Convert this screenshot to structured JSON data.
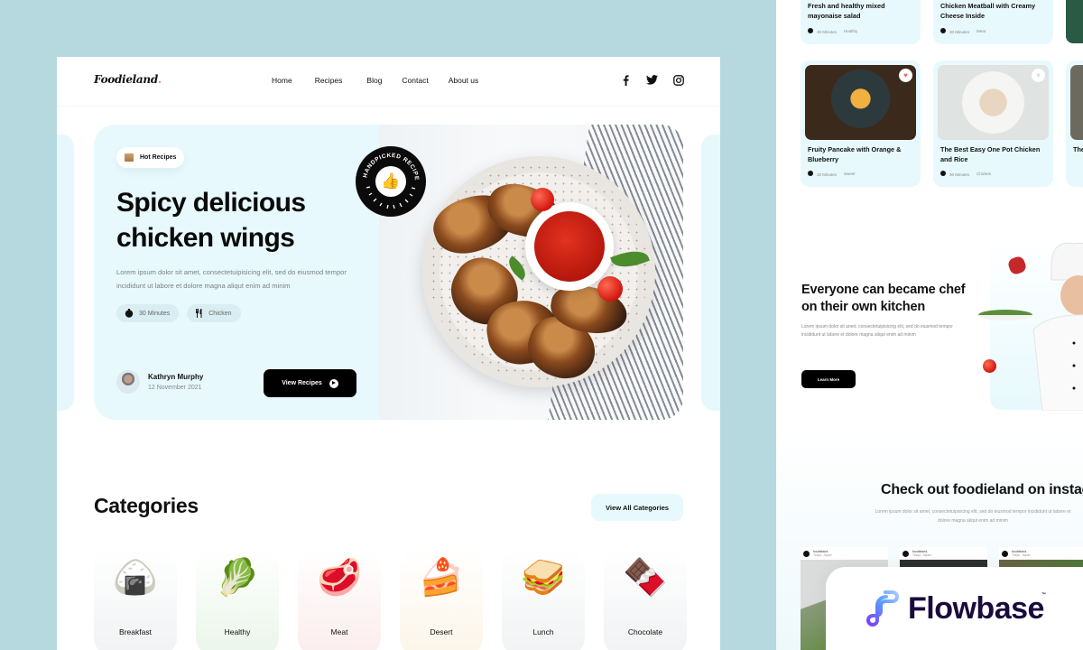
{
  "nav": {
    "logo": "Foodieland",
    "logo_dot": ".",
    "links": [
      "Home",
      "Recipes",
      "Blog",
      "Contact",
      "About us"
    ],
    "socials": [
      "facebook-icon",
      "twitter-icon",
      "instagram-icon"
    ]
  },
  "hero": {
    "tag": "Hot Recipes",
    "title_line1": "Spicy delicious",
    "title_line2": "chicken wings",
    "description": "Lorem ipsum dolor sit amet, consectetuipisicing elit, sed do eiusmod tempor incididunt ut labore et dolore magna aliqut enim ad minim",
    "time": "30 Minutes",
    "category": "Chicken",
    "author_name": "Kathryn Murphy",
    "author_date": "12 November 2021",
    "cta": "View Recipes",
    "badge_text": "HANDPICKED RECIPES"
  },
  "categories": {
    "title": "Categories",
    "view_all": "View All Categories",
    "items": [
      {
        "label": "Breakfast",
        "icon": "🍙",
        "color": "#f0f2f3"
      },
      {
        "label": "Healthy",
        "icon": "🥬",
        "color": "#eaf5ea"
      },
      {
        "label": "Meat",
        "icon": "🥩",
        "color": "#fbecec"
      },
      {
        "label": "Desert",
        "icon": "🍰",
        "color": "#fcf5e8"
      },
      {
        "label": "Lunch",
        "icon": "🥪",
        "color": "#f0f2f3"
      },
      {
        "label": "Chocolate",
        "icon": "🍫",
        "color": "#f0f2f3"
      }
    ]
  },
  "side_panel": {
    "recipes_top": [
      {
        "title": "Fresh and healthy mixed mayonaise salad",
        "time": "30 Minutes",
        "category": "Healthy"
      },
      {
        "title": "Chicken Meatball with Creamy Cheese Inside",
        "time": "30 Minutes",
        "category": "Meat"
      }
    ],
    "recipes": [
      {
        "title": "Fruity Pancake with Orange & Blueberry",
        "time": "30 Minutes",
        "category": "Sweet"
      },
      {
        "title": "The Best Easy One Pot Chicken and Rice",
        "time": "30 Minutes",
        "category": "Chicken"
      },
      {
        "title": "The",
        "time": "",
        "category": ""
      }
    ],
    "chef": {
      "title": "Everyone can became chef on their own kitchen",
      "description": "Lorem ipsum dolor sit amet, consectetuipisicing elit, sed do eiusmod tempor incididunt ut labore et dolore magna aliqut enim ad minim",
      "cta": "Learn More"
    },
    "instagram": {
      "title": "Check out foodieland on instagram",
      "description": "Lorem ipsum dolor sit amet, consectetuipisicing elit, sed do eiusmod tempor incididunt ut labore et dolore magna aliqut enim ad minim",
      "posts": [
        {
          "user": "foodieland.",
          "location": "Tokyo, Japan"
        },
        {
          "user": "foodieland.",
          "location": "Tokyo, Japan"
        },
        {
          "user": "foodieland.",
          "location": "Tokyo, Japan"
        }
      ]
    }
  },
  "watermark": {
    "brand": "Flowbase",
    "tm": "™"
  }
}
